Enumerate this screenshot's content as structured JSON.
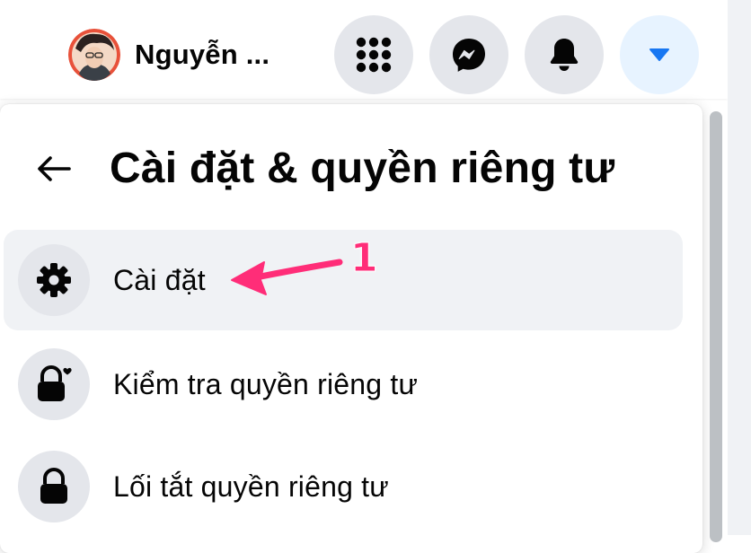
{
  "header": {
    "profile_name": "Nguyễn ...",
    "buttons": [
      {
        "icon": "menu-grid-icon"
      },
      {
        "icon": "messenger-icon"
      },
      {
        "icon": "bell-icon"
      },
      {
        "icon": "caret-down-icon",
        "active": true
      }
    ]
  },
  "panel": {
    "title": "Cài đặt & quyền riêng tư",
    "back_icon": "back-arrow-icon",
    "items": [
      {
        "label": "Cài đặt",
        "icon": "gear-icon"
      },
      {
        "label": "Kiểm tra quyền riêng tư",
        "icon": "lock-heart-icon"
      },
      {
        "label": "Lối tắt quyền riêng tư",
        "icon": "lock-icon"
      }
    ]
  },
  "annotation": {
    "number": "1",
    "color": "#ff2d78"
  },
  "colors": {
    "accent": "#1877f2",
    "button_bg": "#e4e6eb",
    "active_button_bg": "#e7f3ff",
    "hover_bg": "#f0f2f5"
  }
}
